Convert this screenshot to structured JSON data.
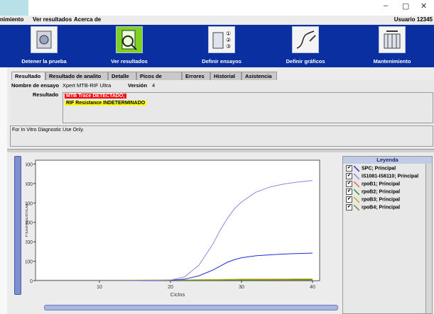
{
  "menu": {
    "items": [
      "nimiento",
      "Ver resultados",
      "Acerca de"
    ],
    "user": "Usuario 12345"
  },
  "toolbar": {
    "buttons": [
      {
        "label": "Detener la prueba",
        "icon": "module-icon"
      },
      {
        "label": "Ver resultados",
        "icon": "view-results-icon"
      },
      {
        "label": "Definir ensayos",
        "icon": "define-assays-icon"
      },
      {
        "label": "Definir gráficos",
        "icon": "graph-icon"
      },
      {
        "label": "Mantenimiento",
        "icon": "maintenance-icon"
      }
    ]
  },
  "tabs": [
    "Resultado",
    "Resultado de analito",
    "Detalle",
    "Picos de fusión",
    "Errores",
    "Historial",
    "Asistencia"
  ],
  "assay": {
    "name_label": "Nombre de ensayo",
    "name_value": "Xpert MTB-RIF Ultra",
    "version_label": "Versión",
    "version_value": "4"
  },
  "result": {
    "label": "Resultado",
    "lines": [
      {
        "text": "MTB Trace DETECTADO;",
        "bg": "#ff0000",
        "color": "#ffffff"
      },
      {
        "text": "RIF Resistance INDETERMINADO",
        "bg": "#ffff00",
        "color": "#000000"
      }
    ]
  },
  "notice": "For In Vitro Diagnostic Use Only.",
  "legend": {
    "title": "Leyenda",
    "items": [
      {
        "label": "SPC; Principal",
        "color": "#1f2bdc"
      },
      {
        "label": "IS1081-IS6110; Principal",
        "color": "#8f84e6"
      },
      {
        "label": "rpoB1; Principal",
        "color": "#e36a2a"
      },
      {
        "label": "rpoB2; Principal",
        "color": "#2a8f2a"
      },
      {
        "label": "rpoB3; Principal",
        "color": "#c9a800"
      },
      {
        "label": "rpoB4; Principal",
        "color": "#6a8f2a"
      }
    ]
  },
  "chart_data": {
    "type": "line",
    "xlabel": "Ciclos",
    "ylabel": "Fluorescencia",
    "xlim": [
      1,
      41
    ],
    "ylim": [
      0,
      620
    ],
    "xticks": [
      10,
      20,
      30,
      40
    ],
    "yticks": [
      0,
      100,
      200,
      300,
      400,
      500,
      600
    ],
    "x": [
      1,
      5,
      10,
      15,
      20,
      22,
      24,
      26,
      27,
      28,
      29,
      30,
      32,
      34,
      36,
      38,
      40
    ],
    "series": [
      {
        "name": "SPC; Principal",
        "color": "#1f2bdc",
        "values": [
          0,
          0,
          0,
          0,
          2,
          8,
          25,
          55,
          75,
          95,
          108,
          118,
          128,
          133,
          137,
          140,
          142
        ]
      },
      {
        "name": "IS1081-IS6110; Principal",
        "color": "#8f84e6",
        "values": [
          0,
          0,
          0,
          0,
          3,
          20,
          80,
          190,
          260,
          320,
          370,
          405,
          455,
          482,
          498,
          508,
          515
        ]
      },
      {
        "name": "rpoB1; Principal",
        "color": "#e36a2a",
        "values": [
          2,
          2,
          2,
          2,
          3,
          3,
          3,
          4,
          4,
          5,
          5,
          5,
          5,
          6,
          6,
          6,
          6
        ]
      },
      {
        "name": "rpoB2; Principal",
        "color": "#2a8f2a",
        "values": [
          1,
          1,
          1,
          1,
          1,
          2,
          2,
          2,
          3,
          3,
          3,
          3,
          3,
          4,
          4,
          4,
          4
        ]
      },
      {
        "name": "rpoB3; Principal",
        "color": "#c9a800",
        "values": [
          3,
          3,
          3,
          3,
          4,
          4,
          5,
          6,
          6,
          7,
          7,
          8,
          8,
          8,
          8,
          9,
          9
        ]
      },
      {
        "name": "rpoB4; Principal",
        "color": "#6a8f2a",
        "values": [
          2,
          2,
          2,
          2,
          2,
          3,
          3,
          3,
          3,
          4,
          4,
          4,
          4,
          4,
          5,
          5,
          5
        ]
      }
    ]
  }
}
